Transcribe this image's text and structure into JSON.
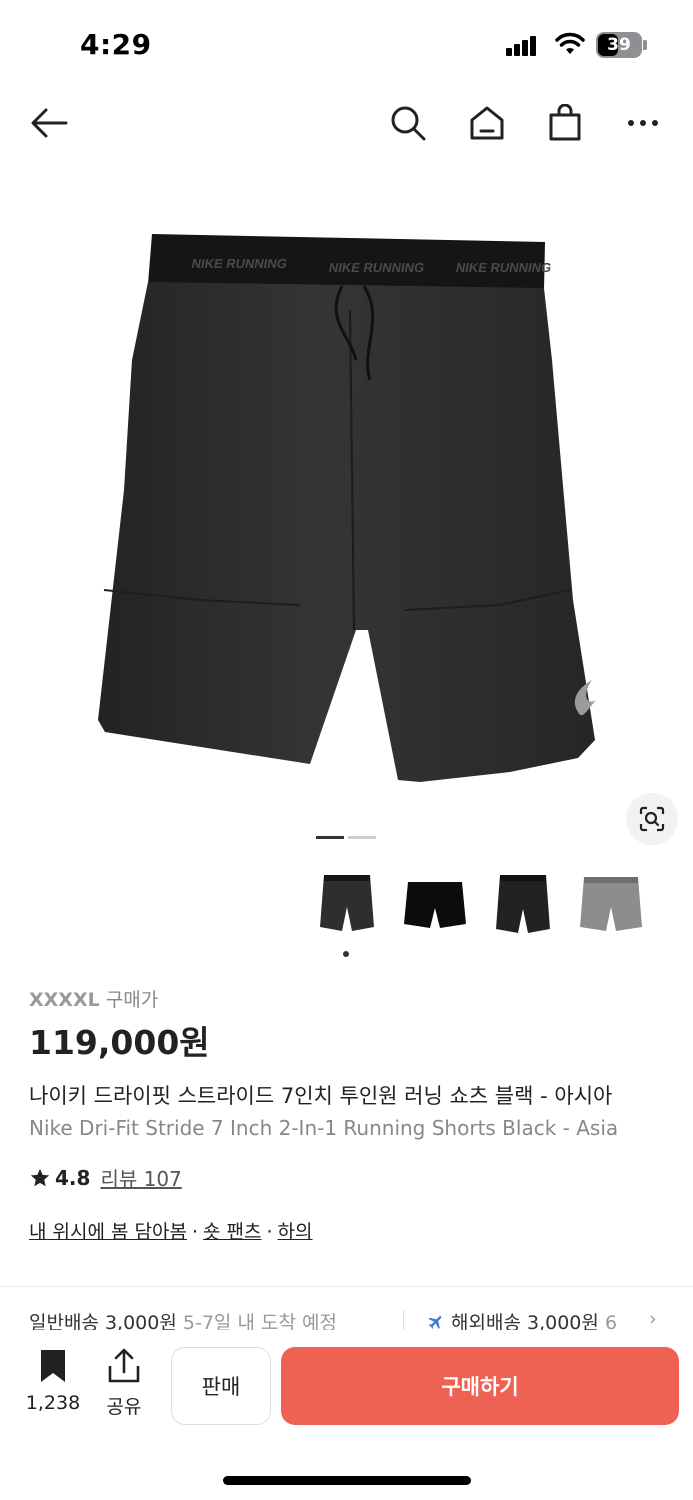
{
  "status_bar": {
    "time": "4:29",
    "battery": "39",
    "icons": [
      "signal-icon",
      "wifi-icon",
      "battery-icon"
    ]
  },
  "top_nav": {
    "icons": [
      "back-arrow-icon",
      "search-icon",
      "home-icon",
      "shopping-bag-icon",
      "more-icon"
    ]
  },
  "product": {
    "image_text": {
      "waistband_brand_left": "NIKE RUNNING",
      "waistband_brand_center": "NIKE RUNNING",
      "waistband_brand_right": "NIKE RUNNING"
    },
    "size": "XXXXL",
    "price_label": "구매가",
    "price": "119,000원",
    "title_ko": "나이키 드라이핏 스트라이드 7인치 투인원 러닝 쇼츠 블랙 - 아시아",
    "title_en": "Nike Dri-Fit Stride 7 Inch 2-In-1 Running Shorts Black - Asia",
    "rating": "4.8",
    "review_label": "리뷰 107",
    "categories": [
      "내 위시에 봄 담아봄",
      "숏 팬츠",
      "하의"
    ],
    "category_separator": "·",
    "thumbnails": [
      "dark-grey-shorts",
      "black-shorts",
      "charcoal-shorts",
      "grey-shorts"
    ],
    "colors": {
      "shorts_dark": "#2e2e2e",
      "shorts_black": "#0c0c0c",
      "shorts_grey": "#8d8d8f"
    }
  },
  "shipping": {
    "standard_label": "일반배송 3,000원",
    "standard_eta": "5-7일 내 도착 예정",
    "intl_label": "해외배송 3,000원",
    "intl_eta": "6",
    "chevron": "›"
  },
  "bottom_bar": {
    "bookmark_count": "1,238",
    "share_label": "공유",
    "sell_label": "판매",
    "buy_label": "구매하기",
    "buy_color": "#ef6253"
  }
}
